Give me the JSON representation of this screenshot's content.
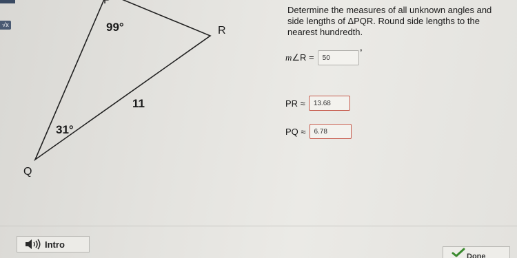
{
  "figure": {
    "vertices": {
      "P": "P",
      "Q": "Q",
      "R": "R"
    },
    "angles": {
      "P": "99°",
      "Q": "31°"
    },
    "side_label": "11"
  },
  "problem": {
    "text": "Determine the measures of all unknown angles and side lengths of ΔPQR. Round side lengths to the nearest hundredth."
  },
  "answers": {
    "angle_r": {
      "label_prefix": "m",
      "label_suffix": "∠R =",
      "value": "50",
      "unit": "°"
    },
    "pr": {
      "label": "PR ≈",
      "value": "13.68"
    },
    "pq": {
      "label": "PQ ≈",
      "value": "6.78"
    }
  },
  "footer": {
    "intro_label": "Intro",
    "done_label": "Done"
  },
  "tools": {
    "sqrt_label": "√x"
  },
  "colors": {
    "answer_border": "#c65a4c",
    "check": "#3a8a2e"
  }
}
